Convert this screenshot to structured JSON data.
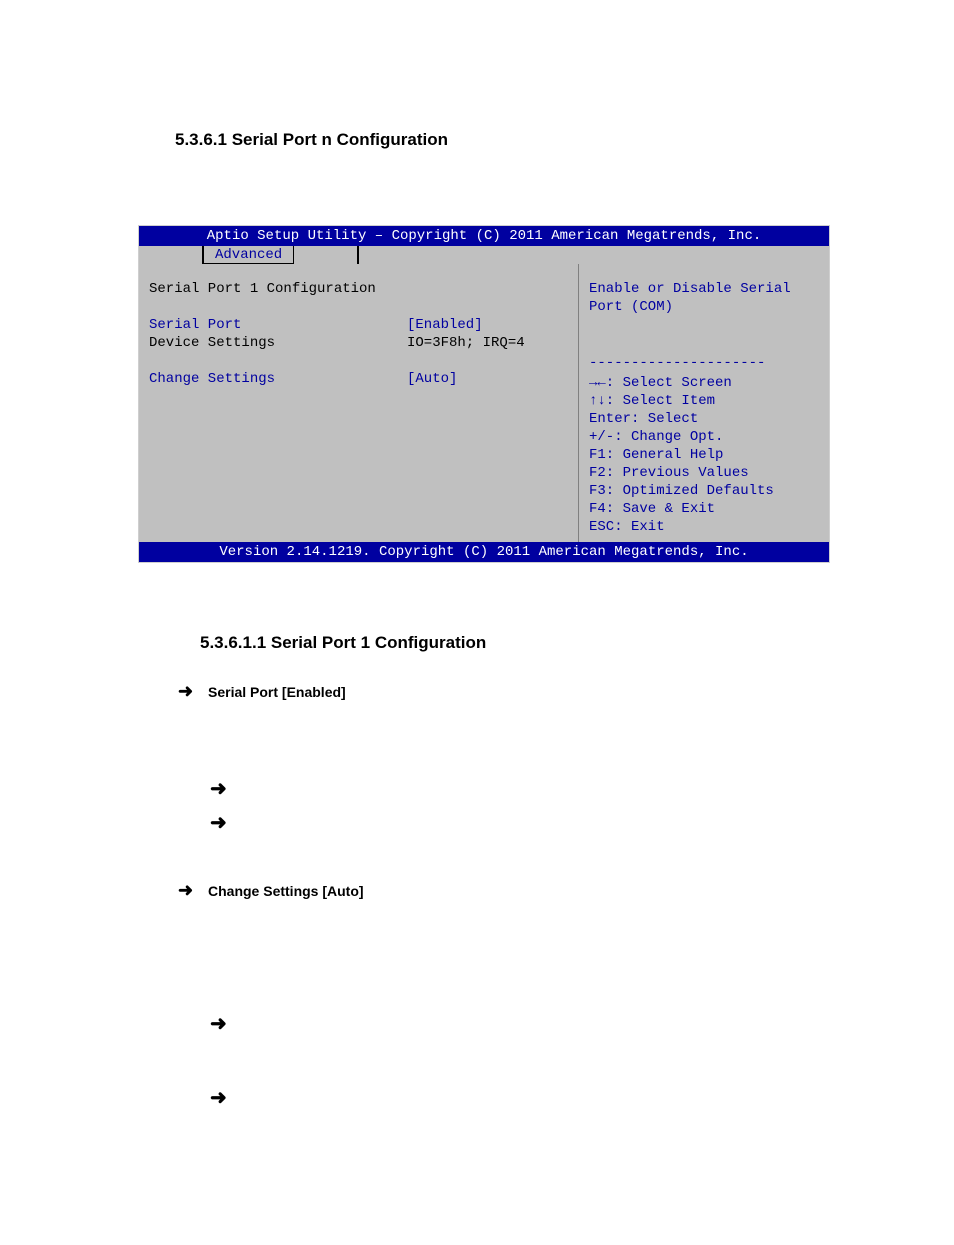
{
  "headings": {
    "h1": "5.3.6.1 Serial Port n Configuration",
    "h2": "5.3.6.1.1 Serial Port 1 Configuration"
  },
  "bios": {
    "title": "Aptio Setup Utility – Copyright (C) 2011 American Megatrends, Inc.",
    "tab": "Advanced",
    "footer": "Version 2.14.1219. Copyright (C) 2011 American Megatrends, Inc.",
    "left": {
      "heading": "Serial Port 1 Configuration",
      "rows": [
        {
          "label": "Serial Port",
          "value": "[Enabled]",
          "labelColor": "blue",
          "valueColor": "blue"
        },
        {
          "label": "Device Settings",
          "value": "IO=3F8h; IRQ=4",
          "labelColor": "black",
          "valueColor": "black"
        }
      ],
      "rows2": [
        {
          "label": "Change Settings",
          "value": "[Auto]",
          "labelColor": "blue",
          "valueColor": "blue"
        }
      ]
    },
    "right": {
      "help1": "Enable or Disable Serial",
      "help2": "Port (COM)",
      "divider": "---------------------",
      "nav": [
        "→←: Select Screen",
        "↑↓: Select Item",
        "Enter: Select",
        "+/-:  Change Opt.",
        "F1:  General Help",
        "F2:  Previous Values",
        "F3:  Optimized Defaults",
        "F4:  Save & Exit",
        "ESC: Exit"
      ]
    }
  },
  "bullets": {
    "b1": "Serial Port [Enabled]",
    "b2": "Change Settings [Auto]"
  }
}
